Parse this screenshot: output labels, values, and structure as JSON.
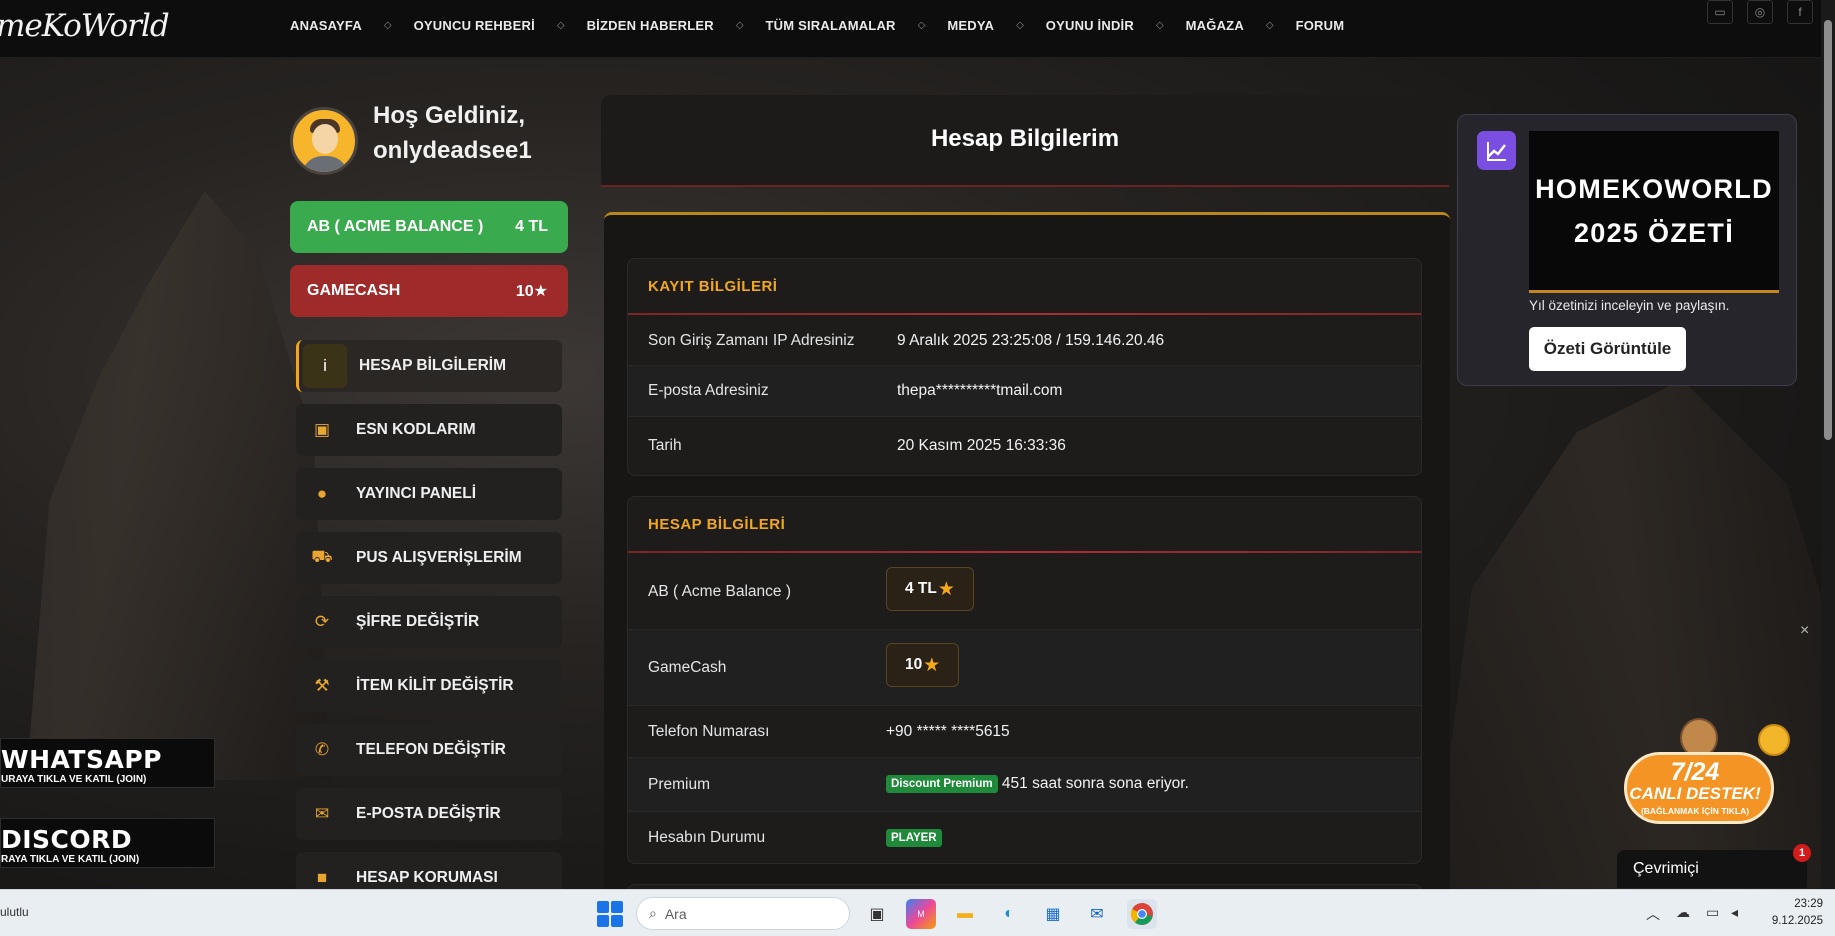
{
  "nav": {
    "logo": "meKoWorld",
    "items": [
      "ANASAYFA",
      "OYUNCU REHBERİ",
      "BİZDEN HABERLER",
      "TÜM SIRALAMALAR",
      "MEDYA",
      "OYUNU İNDİR",
      "MAĞAZA",
      "FORUM"
    ],
    "separator": "◇",
    "social_icons": [
      "discord-icon",
      "instagram-icon",
      "facebook-icon"
    ]
  },
  "welcome": {
    "line1": "Hoş Geldiniz,",
    "username": "onlydeadsee1"
  },
  "balances": {
    "ab_label": "AB ( ACME BALANCE )",
    "ab_value": "4 TL",
    "gc_label": "GAMECASH",
    "gc_value": "10",
    "ab_color": "#3aaa4f",
    "gc_color": "#9f2a2a"
  },
  "sidebar": {
    "items": [
      {
        "label": "HESAP BİLGİLERİM",
        "icon": "info-icon",
        "glyph": "i",
        "active": true
      },
      {
        "label": "ESN KODLARIM",
        "icon": "money-icon",
        "glyph": "▣"
      },
      {
        "label": "YAYINCI PANELİ",
        "icon": "user-icon",
        "glyph": "●"
      },
      {
        "label": "PUS ALIŞVERİŞLERİM",
        "icon": "cart-icon",
        "glyph": "⛟"
      },
      {
        "label": "ŞİFRE DEĞİŞTİR",
        "icon": "refresh-icon",
        "glyph": "⟳"
      },
      {
        "label": "İTEM KİLİT DEĞİŞTİR",
        "icon": "gavel-icon",
        "glyph": "⚒"
      },
      {
        "label": "TELEFON DEĞİŞTİR",
        "icon": "phone-icon",
        "glyph": "✆"
      },
      {
        "label": "E-POSTA DEĞİŞTİR",
        "icon": "envelope-icon",
        "glyph": "✉"
      },
      {
        "label": "HESAP KORUMASI",
        "icon": "lock-icon",
        "glyph": "■"
      }
    ]
  },
  "banners": {
    "whatsapp_title": "WHATSAPP",
    "whatsapp_sub": "URAYA TIKLA VE KATIL (JOIN)",
    "discord_title": "DISCORD",
    "discord_sub": "RAYA TIKLA VE KATIL (JOIN)"
  },
  "main": {
    "title": "Hesap Bilgilerim",
    "kayit": {
      "title": "KAYIT BİLGİLERİ",
      "rows": [
        {
          "label": "Son Giriş Zamanı IP Adresiniz",
          "value": "9 Aralık 2025 23:25:08 / 159.146.20.46"
        },
        {
          "label": "E-posta Adresiniz",
          "value": "thepa**********tmail.com"
        },
        {
          "label": "Tarih",
          "value": "20 Kasım 2025 16:33:36"
        }
      ]
    },
    "hesap": {
      "title": "HESAP BİLGİLERİ",
      "ab_label": "AB ( Acme Balance )",
      "ab_value": "4 TL",
      "gc_label": "GameCash",
      "gc_value": "10",
      "phone_label": "Telefon Numarası",
      "phone_value": "+90 ***** ****5615",
      "premium_label": "Premium",
      "premium_badge": "Discount Premium",
      "premium_text": "451 saat sonra sona eriyor.",
      "status_label": "Hesabın Durumu",
      "status_badge": "PLAYER"
    },
    "star": "★"
  },
  "widget": {
    "poster_line1": "HOMEKOWORLD",
    "poster_line2": "2025 ÖZETİ",
    "text": "Yıl özetinizi inceleyin ve paylaşın.",
    "button": "Özeti Görüntüle",
    "icon": "chart-line-icon",
    "accent": "#7a4ee0"
  },
  "support": {
    "line1": "7/24",
    "line2": "CANLI DESTEK!",
    "line3": "(BAĞLANMAK İÇİN TIKLA)",
    "close": "×"
  },
  "chat": {
    "label": "Çevrimiçi",
    "count": "1"
  },
  "taskbar": {
    "left_text": "ulutlu",
    "search_placeholder": "Ara",
    "time": "23:29",
    "date": "9.12.2025"
  }
}
